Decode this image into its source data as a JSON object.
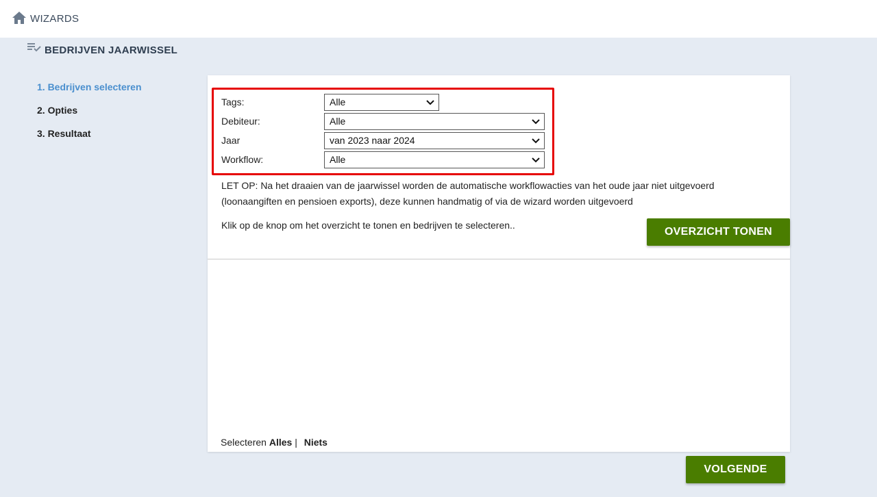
{
  "topbar": {
    "title": "WIZARDS",
    "icon": "home-icon"
  },
  "page": {
    "title": "BEDRIJVEN JAARWISSEL",
    "icon": "checklist-icon"
  },
  "steps": [
    {
      "label": "1. Bedrijven selecteren",
      "active": true
    },
    {
      "label": "2. Opties",
      "active": false
    },
    {
      "label": "3. Resultaat",
      "active": false
    }
  ],
  "filters": {
    "tags": {
      "label": "Tags:",
      "value": "Alle"
    },
    "debiteur": {
      "label": "Debiteur:",
      "value": "Alle"
    },
    "jaar": {
      "label": "Jaar",
      "value": "van 2023 naar 2024"
    },
    "workflow": {
      "label": "Workflow:",
      "value": "Alle"
    }
  },
  "notice": "LET OP: Na het draaien van de jaarwissel worden de automatische workflowacties van het oude jaar niet uitgevoerd (loonaangiften en pensioen exports), deze kunnen handmatig of via de wizard worden uitgevoerd",
  "hint": "Klik op de knop om het overzicht te tonen en bedrijven te selecteren..",
  "buttons": {
    "overzicht": "OVERZICHT TONEN",
    "volgende": "VOLGENDE"
  },
  "selection": {
    "prefix": "Selecteren",
    "all": "Alles",
    "separator": "|",
    "none": "Niets"
  },
  "colors": {
    "accent": "#4a8fce",
    "button": "#4a7d00",
    "highlight": "#e60000",
    "background": "#e5ebf3"
  }
}
